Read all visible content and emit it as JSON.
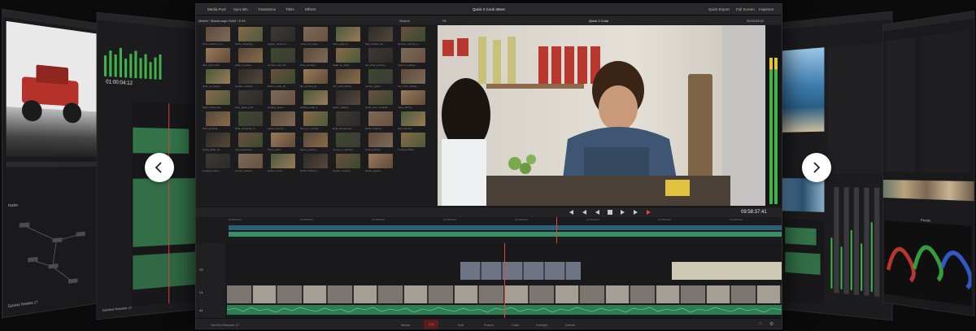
{
  "window": {
    "title": "Quick 2 Cook 30sec"
  },
  "toolbar": {
    "media_pool": "Media Pool",
    "sync_bin": "Sync Bin",
    "transitions": "Transitions",
    "titles": "Titles",
    "effects": "Effects",
    "quick_export": "Quick Export",
    "full_screen": "Full Screen",
    "inspector": "Inspector"
  },
  "media_pool": {
    "path": "Master / Blackmagic RAW / 8 Kit",
    "search": "Search",
    "clips": [
      "chef_cooking_tom...",
      "herbs_chopping...",
      "grapes_rinsed_w...",
      "meal_red_grape...",
      "fried_eggs_on...",
      "dark_kitchen_ch...",
      "woman_opening_v...",
      "dark_grill_cook...",
      "plate_of_pasta...",
      "woman_and_red...",
      "wine_pouring...",
      "salad_on_table...",
      "red_wine_pouring...",
      "mason_cooking...",
      "knife_on_board...",
      "people_cooking...",
      "kitchen_wide_sh...",
      "fire_pouring_wi...",
      "red_meat_slicing...",
      "tomato_pasta...",
      "red_onion_slicing...",
      "fresh_bread_loa...",
      "wine_glass_pour...",
      "cooking_green...",
      "cutting_board_s...",
      "pasta_making...",
      "wood_oven_cooking...",
      "meat_slicing...",
      "herb_growing...",
      "knife_chopping_w...",
      "sauce_pan_fry...",
      "flour_on_counter...",
      "knife_sharpening...",
      "herbs_cooking...",
      "chef_woman...",
      "dining_table_wi...",
      "salt_seasoning...",
      "fresh_pasta...",
      "herbs_growing...",
      "women_in_kitchen...",
      "bread_slicing...",
      "Cooking Show...",
      "Cooking scene i...",
      "women_kitchen...",
      "kitchen_work...",
      "White's Kitchen...",
      "people_cooking...",
      "dinner_guests..."
    ]
  },
  "viewer": {
    "name": "Quick 2 Cook",
    "zoom": "Fit",
    "source_timecode": "00:00:53:22"
  },
  "transport": {
    "timecode": "09:58:37:41"
  },
  "timeline": {
    "ruler_marks": [
      "00:59:00:00",
      "01:00:00:00",
      "01:00:00:00",
      "01:00:00:00",
      "01:00:00:00",
      "01:00:00:00",
      "01:00:00:00",
      "01:00:00:00"
    ],
    "tracks": [
      "V2",
      "V1",
      "A1"
    ]
  },
  "pages": {
    "app_name": "DaVinci Resolve 17",
    "items": [
      "Media",
      "Cut",
      "Edit",
      "Fusion",
      "Color",
      "Fairlight",
      "Deliver"
    ],
    "active": "Cut"
  },
  "left_panels": {
    "app_name": "DaVinci Resolve 17",
    "timecode": "01:00:04:12",
    "nodes_label": "Nodes"
  },
  "right_panels": {
    "parade_label": "Parade"
  },
  "carousel": {
    "prev_label": "previous",
    "next_label": "next"
  }
}
